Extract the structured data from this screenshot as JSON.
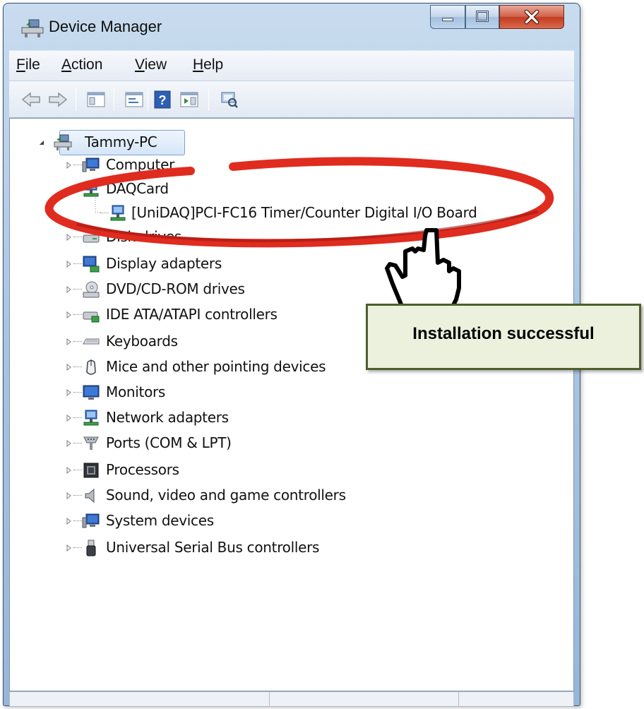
{
  "window": {
    "title": "Device Manager"
  },
  "menu": [
    {
      "label": "File"
    },
    {
      "label": "Action"
    },
    {
      "label": "View"
    },
    {
      "label": "Help"
    }
  ],
  "toolbar": {
    "back_icon": "back-arrow-icon",
    "forward_icon": "forward-arrow-icon",
    "buttons": [
      "show-hide-console-tree-icon",
      "properties-icon",
      "help-icon",
      "action-pane-icon",
      "scan-hardware-icon"
    ]
  },
  "tree": {
    "root": "Tammy-PC",
    "categories": [
      {
        "label": "Computer",
        "icon": "computer-icon"
      },
      {
        "label": "DAQCard",
        "icon": "daq-card-icon",
        "expanded": true,
        "children": [
          {
            "label": "[UniDAQ]PCI-FC16 Timer/Counter Digital I/O Board",
            "icon": "daq-device-icon"
          }
        ]
      },
      {
        "label": "Disk drives",
        "icon": "disk-drive-icon"
      },
      {
        "label": "Display adapters",
        "icon": "display-adapter-icon"
      },
      {
        "label": "DVD/CD-ROM drives",
        "icon": "dvd-drive-icon"
      },
      {
        "label": "IDE ATA/ATAPI controllers",
        "icon": "ide-controller-icon"
      },
      {
        "label": "Keyboards",
        "icon": "keyboard-icon"
      },
      {
        "label": "Mice and other pointing devices",
        "icon": "mouse-icon"
      },
      {
        "label": "Monitors",
        "icon": "monitor-icon"
      },
      {
        "label": "Network adapters",
        "icon": "network-adapter-icon"
      },
      {
        "label": "Ports (COM & LPT)",
        "icon": "port-icon"
      },
      {
        "label": "Processors",
        "icon": "processor-icon"
      },
      {
        "label": "Sound, video and game controllers",
        "icon": "sound-icon"
      },
      {
        "label": "System devices",
        "icon": "system-device-icon"
      },
      {
        "label": "Universal Serial Bus controllers",
        "icon": "usb-icon"
      }
    ]
  },
  "callout": {
    "text": "Installation successful"
  },
  "colors": {
    "highlight_ellipse": "#e02b1f",
    "callout_fill": "#ebf1dd",
    "callout_border": "#4d5f2e"
  }
}
